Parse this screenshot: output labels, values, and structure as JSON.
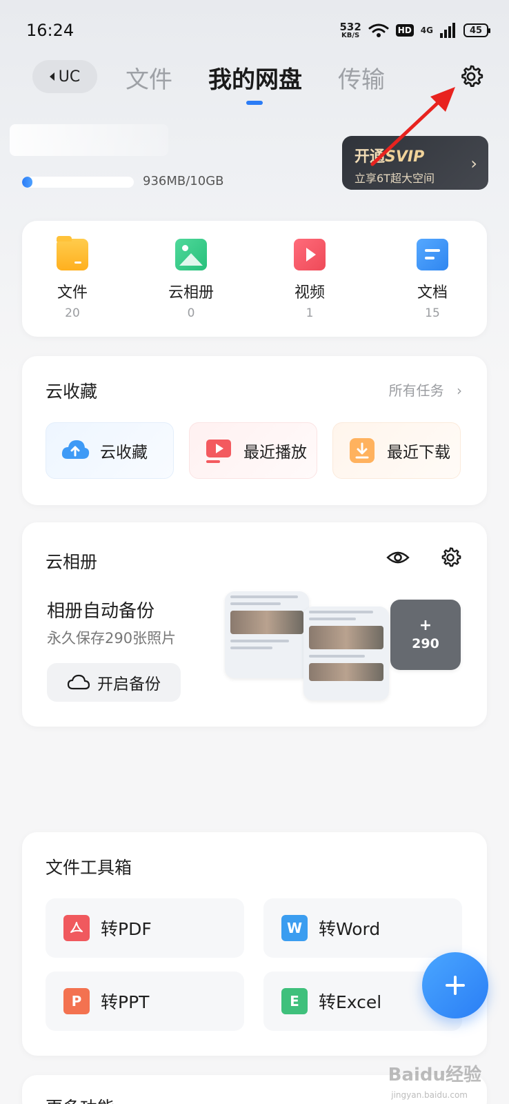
{
  "status_bar": {
    "time": "16:24",
    "net_speed_value": "532",
    "net_speed_unit": "KB/S",
    "hd": "HD",
    "network": "4G",
    "battery": "45"
  },
  "header": {
    "back_label": "UC",
    "tabs": [
      {
        "label": "文件",
        "active": false
      },
      {
        "label": "我的网盘",
        "active": true
      },
      {
        "label": "传输",
        "active": false
      }
    ],
    "accent_color": "#2b7cf6"
  },
  "storage": {
    "used_text": "936MB/10GB",
    "used_fraction": 0.09
  },
  "svip": {
    "prefix": "开通",
    "brand": "SVIP",
    "subtitle": "立享6T超大空间"
  },
  "categories": [
    {
      "label": "文件",
      "count": "20",
      "icon": "folder-icon"
    },
    {
      "label": "云相册",
      "count": "0",
      "icon": "album-icon"
    },
    {
      "label": "视频",
      "count": "1",
      "icon": "video-icon"
    },
    {
      "label": "文档",
      "count": "15",
      "icon": "document-icon"
    }
  ],
  "cloud_collect": {
    "title": "云收藏",
    "all_tasks": "所有任务",
    "chips": [
      {
        "label": "云收藏",
        "icon": "cloud-upload-icon"
      },
      {
        "label": "最近播放",
        "icon": "play-icon"
      },
      {
        "label": "最近下载",
        "icon": "download-icon"
      }
    ]
  },
  "cloud_album": {
    "title": "云相册",
    "backup_title": "相册自动备份",
    "backup_subtitle": "永久保存290张照片",
    "backup_button": "开启备份",
    "extra_plus": "+",
    "extra_count": "290"
  },
  "toolbox": {
    "title": "文件工具箱",
    "tools": [
      {
        "label": "转PDF",
        "glyph": "",
        "color": "#f0595e"
      },
      {
        "label": "转Word",
        "glyph": "W",
        "color": "#3b9df0"
      },
      {
        "label": "转PPT",
        "glyph": "P",
        "color": "#f37250"
      },
      {
        "label": "转Excel",
        "glyph": "E",
        "color": "#3fc07c"
      }
    ]
  },
  "more": {
    "title": "更多功能"
  },
  "watermark": {
    "main": "Baidu经验",
    "sub": "jingyan.baidu.com"
  }
}
